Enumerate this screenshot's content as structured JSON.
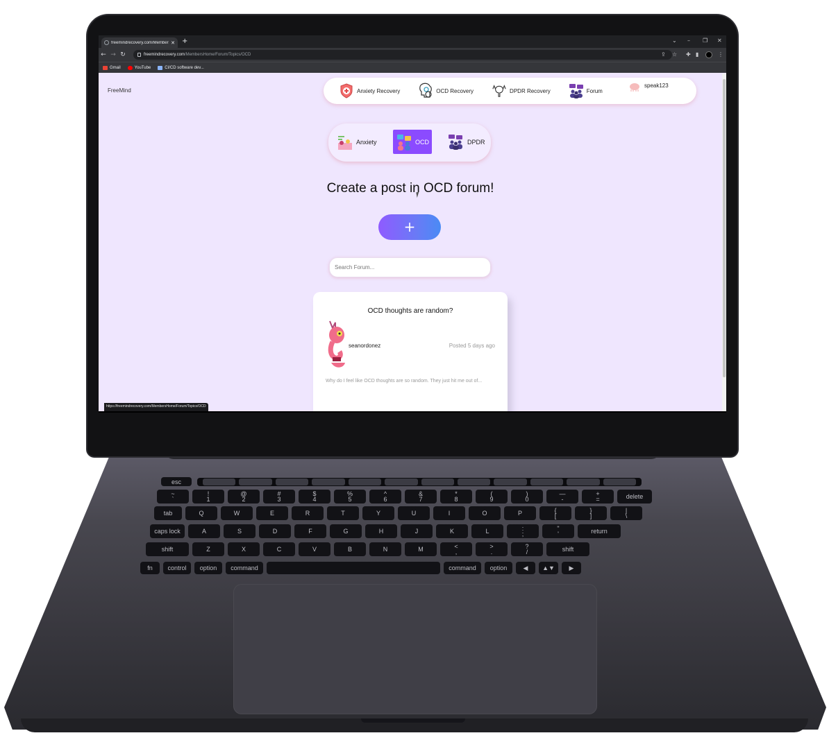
{
  "browser": {
    "tab_title": "freemindrecovery.com/MembersHom",
    "url_host": "freemindrecovery.com",
    "url_path": "/MembersHome/Forum/Topics/OCD",
    "bookmarks": [
      {
        "label": "Gmail",
        "color": "#ea4335"
      },
      {
        "label": "YouTube",
        "color": "#ff0000"
      },
      {
        "label": "CI/CD software dev...",
        "color": "#8ab4f8"
      }
    ],
    "status_url": "https://freemindrecovery.com/MembersHome/Forum/Topics/OCD"
  },
  "site": {
    "brand": "FreeMind",
    "nav": [
      {
        "label": "Anxiety Recovery",
        "icon": "shield-cross-icon"
      },
      {
        "label": "OCD Recovery",
        "icon": "brain-gear-icon"
      },
      {
        "label": "DPDR Recovery",
        "icon": "brain-hands-icon"
      },
      {
        "label": "Forum",
        "icon": "people-chat-icon"
      }
    ],
    "username": "speak123"
  },
  "topics": {
    "items": [
      {
        "label": "Anxiety",
        "active": false
      },
      {
        "label": "OCD",
        "active": true
      },
      {
        "label": "DPDR",
        "active": false
      }
    ],
    "accent": "#8b4bff"
  },
  "main": {
    "headline": "Create a post in OCD forum!",
    "add_button": "+",
    "search_placeholder": "Search Forum..."
  },
  "posts": [
    {
      "title": "OCD thoughts are random?",
      "author": "seanordonez",
      "time": "Posted 5 days ago",
      "excerpt": "Why do I feel like OCD thoughts are so random. They just hit me out of..."
    }
  ],
  "keyboard": {
    "row1": [
      "esc"
    ],
    "row2": [
      "~\n`",
      "!\n1",
      "@\n2",
      "#\n3",
      "$\n4",
      "%\n5",
      "^\n6",
      "&\n7",
      "*\n8",
      "(\n9",
      ")\n0",
      "—\n-",
      "+\n=",
      "delete"
    ],
    "row3": [
      "tab",
      "Q",
      "W",
      "E",
      "R",
      "T",
      "Y",
      "U",
      "I",
      "O",
      "P",
      "{\n[",
      "}\n]",
      "|\n\\"
    ],
    "row4": [
      "caps lock",
      "A",
      "S",
      "D",
      "F",
      "G",
      "H",
      "J",
      "K",
      "L",
      ":\n;",
      "\"\n'",
      "return"
    ],
    "row5": [
      "shift",
      "Z",
      "X",
      "C",
      "V",
      "B",
      "N",
      "M",
      "<\n,",
      ">\n.",
      "?\n/",
      "shift"
    ],
    "row6": [
      "fn",
      "control",
      "option",
      "command",
      "",
      "command",
      "option",
      "◀",
      "▲▼",
      "▶"
    ]
  }
}
